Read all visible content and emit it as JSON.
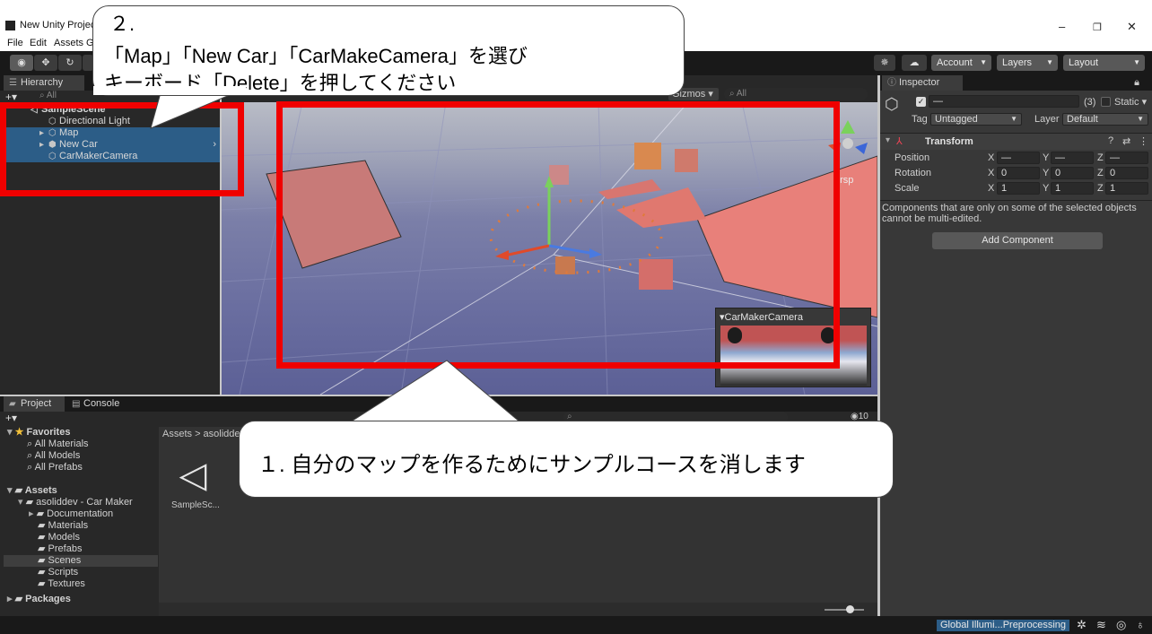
{
  "window": {
    "title": "New Unity Project",
    "menu": [
      "File",
      "Edit",
      "Assets",
      "G"
    ],
    "controls": {
      "minimize": "–",
      "maximize": "❐",
      "close": "✕"
    }
  },
  "toolbar": {
    "account": "Account",
    "layers": "Layers",
    "layout": "Layout"
  },
  "hierarchy": {
    "tab": "Hierarchy",
    "search_placeholder": "All",
    "scene": "SampleScene",
    "items": [
      {
        "label": "Directional Light",
        "selected": false
      },
      {
        "label": "Map",
        "selected": true
      },
      {
        "label": "New Car",
        "selected": true
      },
      {
        "label": "CarMakerCamera",
        "selected": true
      }
    ]
  },
  "scene": {
    "gizmos": "Gizmos",
    "search_placeholder": "All",
    "persp": "ersp",
    "camera_preview": "CarMakerCamera"
  },
  "inspector": {
    "tab": "Inspector",
    "name_value": "—",
    "multi_count": "(3)",
    "static_label": "Static",
    "tag_label": "Tag",
    "tag_value": "Untagged",
    "layer_label": "Layer",
    "layer_value": "Default",
    "component": "Transform",
    "rows": [
      {
        "label": "Position",
        "x": "—",
        "y": "—",
        "z": "—"
      },
      {
        "label": "Rotation",
        "x": "0",
        "y": "0",
        "z": "0"
      },
      {
        "label": "Scale",
        "x": "1",
        "y": "1",
        "z": "1"
      }
    ],
    "axis_x": "X",
    "axis_y": "Y",
    "axis_z": "Z",
    "note": "Components that are only on some of the selected objects cannot be multi-edited.",
    "add_component": "Add Component"
  },
  "project": {
    "tab_project": "Project",
    "tab_console": "Console",
    "breadcrumb": "Assets > asolidde",
    "favorites": "Favorites",
    "fav_items": [
      "All Materials",
      "All Models",
      "All Prefabs"
    ],
    "assets": "Assets",
    "asset_root": "asoliddev - Car Maker",
    "folders": [
      "Documentation",
      "Materials",
      "Models",
      "Prefabs",
      "Scenes",
      "Scripts",
      "Textures"
    ],
    "packages": "Packages",
    "file_name": "SampleSc...",
    "badge_count": "10"
  },
  "status": {
    "text": "Global Illumi...Preprocessing"
  },
  "callouts": {
    "step2_number": "２.",
    "step2_line1": "「Map」「New Car」「CarMakeCamera」を選び",
    "step2_line2": "キーボード「Delete」を押してください",
    "step1_text": "１. 自分のマップを作るためにサンプルコースを消します"
  },
  "colors": {
    "highlight_red": "#f00000",
    "selection_blue": "#2c5d87",
    "editor_dark": "#282828"
  }
}
